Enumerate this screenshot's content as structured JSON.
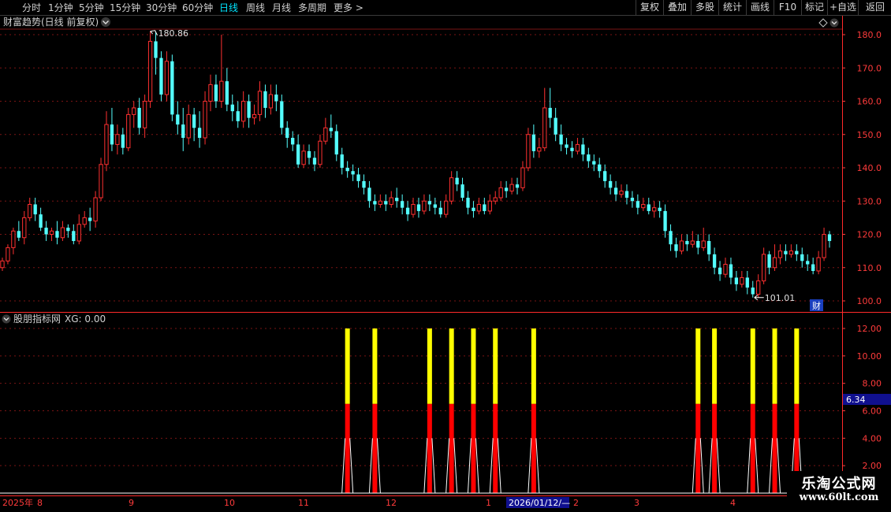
{
  "toolbar": {
    "periods": [
      {
        "label": "分时",
        "active": false
      },
      {
        "label": "1分钟",
        "active": false
      },
      {
        "label": "5分钟",
        "active": false
      },
      {
        "label": "15分钟",
        "active": false
      },
      {
        "label": "30分钟",
        "active": false
      },
      {
        "label": "60分钟",
        "active": false
      },
      {
        "label": "日线",
        "active": true
      },
      {
        "label": "周线",
        "active": false
      },
      {
        "label": "月线",
        "active": false
      },
      {
        "label": "多周期",
        "active": false
      },
      {
        "label": "更多 >",
        "active": false
      }
    ],
    "right_buttons": [
      "复权",
      "叠加",
      "多股",
      "统计",
      "画线",
      "F10",
      "标记",
      "+自选",
      "返回"
    ]
  },
  "main_panel": {
    "title": "财富趋势(日线 前复权)",
    "high_label": "180.86",
    "low_label": "101.01",
    "cai_badge": "财",
    "y_ticks": [
      "180.0",
      "170.0",
      "160.0",
      "150.0",
      "140.0",
      "130.0",
      "120.0",
      "110.0",
      "100.0"
    ]
  },
  "indicator_panel": {
    "title": "股朋指标网",
    "xg_label": "XG: 0.00",
    "cursor_value": "6.34",
    "y_ticks": [
      "12.00",
      "10.00",
      "8.00",
      "6.00",
      "4.00",
      "2.00"
    ]
  },
  "date_axis": {
    "labels": [
      "2025年",
      "8",
      "9",
      "10",
      "11",
      "12",
      "1",
      "2026/01/12/—",
      "2",
      "3",
      "4"
    ]
  },
  "watermark": {
    "line1": "乐淘公式网",
    "line2": "www.60lt.com"
  },
  "colors": {
    "up": "#ff3030",
    "down": "#54ffff",
    "signal_top": "#ffff00",
    "signal_bottom": "#ff0000",
    "axis": "#ff3b3b",
    "grid": "#7a1414"
  },
  "chart_data": {
    "type": "candlestick",
    "ylim": [
      99,
      183
    ],
    "candles": [
      [
        110,
        112,
        113,
        109
      ],
      [
        112,
        116,
        117,
        111
      ],
      [
        116,
        121,
        122,
        114
      ],
      [
        121,
        119,
        124,
        118
      ],
      [
        119,
        125,
        127,
        117
      ],
      [
        125,
        129,
        131,
        124
      ],
      [
        129,
        126,
        131,
        124
      ],
      [
        126,
        122,
        128,
        121
      ],
      [
        122,
        120,
        124,
        118
      ],
      [
        120,
        121,
        122,
        118
      ],
      [
        121,
        119,
        124,
        117
      ],
      [
        119,
        122,
        124,
        118
      ],
      [
        122,
        121,
        123,
        119
      ],
      [
        121,
        118,
        123,
        117
      ],
      [
        118,
        123,
        126,
        117
      ],
      [
        123,
        125,
        127,
        122
      ],
      [
        125,
        124,
        128,
        121
      ],
      [
        124,
        131,
        133,
        122
      ],
      [
        131,
        141,
        143,
        130
      ],
      [
        141,
        153,
        157,
        139
      ],
      [
        153,
        147,
        158,
        145
      ],
      [
        147,
        150,
        153,
        144
      ],
      [
        150,
        146,
        152,
        144
      ],
      [
        146,
        156,
        158,
        145
      ],
      [
        156,
        158,
        160,
        152
      ],
      [
        158,
        152,
        161,
        150
      ],
      [
        152,
        160,
        162,
        149
      ],
      [
        160,
        178,
        181,
        158
      ],
      [
        178,
        173,
        181,
        168
      ],
      [
        173,
        162,
        175,
        160
      ],
      [
        162,
        172,
        175,
        160
      ],
      [
        172,
        156,
        174,
        154
      ],
      [
        156,
        153,
        160,
        150
      ],
      [
        153,
        149,
        158,
        145
      ],
      [
        149,
        156,
        159,
        147
      ],
      [
        156,
        152,
        158,
        148
      ],
      [
        152,
        149,
        157,
        146
      ],
      [
        149,
        160,
        163,
        147
      ],
      [
        160,
        165,
        168,
        157
      ],
      [
        165,
        160,
        168,
        158
      ],
      [
        160,
        166,
        180,
        158
      ],
      [
        166,
        159,
        170,
        157
      ],
      [
        159,
        157,
        162,
        154
      ],
      [
        157,
        154,
        160,
        152
      ],
      [
        154,
        160,
        163,
        152
      ],
      [
        160,
        155,
        162,
        152
      ],
      [
        155,
        156,
        159,
        153
      ],
      [
        156,
        163,
        166,
        154
      ],
      [
        163,
        158,
        165,
        155
      ],
      [
        158,
        162,
        165,
        156
      ],
      [
        162,
        160,
        165,
        157
      ],
      [
        160,
        152,
        162,
        150
      ],
      [
        152,
        149,
        154,
        146
      ],
      [
        149,
        147,
        151,
        145
      ],
      [
        147,
        141,
        150,
        140
      ],
      [
        141,
        145,
        147,
        140
      ],
      [
        145,
        143,
        147,
        141
      ],
      [
        143,
        141,
        145,
        139
      ],
      [
        141,
        148,
        150,
        140
      ],
      [
        148,
        152,
        155,
        147
      ],
      [
        152,
        151,
        156,
        149
      ],
      [
        151,
        144,
        153,
        142
      ],
      [
        144,
        140,
        146,
        138
      ],
      [
        140,
        139,
        142,
        137
      ],
      [
        139,
        138,
        141,
        136
      ],
      [
        138,
        136,
        140,
        134
      ],
      [
        136,
        134,
        138,
        132
      ],
      [
        134,
        130,
        136,
        128
      ],
      [
        130,
        129,
        132,
        127
      ],
      [
        129,
        130,
        132,
        128
      ],
      [
        130,
        129,
        132,
        127
      ],
      [
        129,
        131,
        133,
        128
      ],
      [
        131,
        130,
        134,
        128
      ],
      [
        130,
        128,
        132,
        126
      ],
      [
        128,
        126,
        130,
        124
      ],
      [
        126,
        129,
        131,
        125
      ],
      [
        129,
        127,
        131,
        125
      ],
      [
        127,
        130,
        132,
        126
      ],
      [
        130,
        129,
        132,
        127
      ],
      [
        129,
        128,
        131,
        126
      ],
      [
        128,
        126,
        130,
        125
      ],
      [
        126,
        130,
        132,
        125
      ],
      [
        130,
        137,
        139,
        129
      ],
      [
        137,
        135,
        139,
        133
      ],
      [
        135,
        131,
        137,
        130
      ],
      [
        131,
        128,
        133,
        126
      ],
      [
        128,
        127,
        130,
        125
      ],
      [
        127,
        129,
        131,
        126
      ],
      [
        129,
        127,
        131,
        126
      ],
      [
        127,
        130,
        132,
        126
      ],
      [
        130,
        131,
        133,
        129
      ],
      [
        131,
        134,
        136,
        130
      ],
      [
        134,
        133,
        136,
        131
      ],
      [
        133,
        135,
        137,
        132
      ],
      [
        135,
        134,
        137,
        132
      ],
      [
        134,
        140,
        142,
        133
      ],
      [
        140,
        150,
        152,
        139
      ],
      [
        150,
        145,
        153,
        143
      ],
      [
        145,
        146,
        149,
        143
      ],
      [
        146,
        158,
        164,
        145
      ],
      [
        158,
        155,
        164,
        152
      ],
      [
        155,
        150,
        158,
        148
      ],
      [
        150,
        147,
        153,
        145
      ],
      [
        147,
        146,
        149,
        144
      ],
      [
        146,
        145,
        148,
        143
      ],
      [
        145,
        147,
        149,
        144
      ],
      [
        147,
        144,
        149,
        142
      ],
      [
        144,
        142,
        146,
        140
      ],
      [
        142,
        141,
        144,
        139
      ],
      [
        141,
        139,
        143,
        137
      ],
      [
        139,
        136,
        141,
        134
      ],
      [
        136,
        134,
        138,
        132
      ],
      [
        134,
        132,
        136,
        130
      ],
      [
        132,
        133,
        135,
        131
      ],
      [
        133,
        131,
        135,
        129
      ],
      [
        131,
        130,
        133,
        128
      ],
      [
        130,
        128,
        132,
        126
      ],
      [
        128,
        129,
        131,
        127
      ],
      [
        129,
        127,
        131,
        126
      ],
      [
        127,
        128,
        130,
        125
      ],
      [
        128,
        127,
        130,
        125
      ],
      [
        127,
        121,
        129,
        119
      ],
      [
        121,
        117,
        123,
        115
      ],
      [
        117,
        115,
        119,
        113
      ],
      [
        115,
        118,
        120,
        114
      ],
      [
        118,
        117,
        120,
        115
      ],
      [
        117,
        118,
        121,
        116
      ],
      [
        118,
        116,
        120,
        114
      ],
      [
        116,
        118,
        122,
        115
      ],
      [
        118,
        114,
        120,
        112
      ],
      [
        114,
        110,
        116,
        108
      ],
      [
        110,
        108,
        112,
        106
      ],
      [
        108,
        111,
        113,
        107
      ],
      [
        111,
        107,
        113,
        105
      ],
      [
        107,
        105,
        109,
        103
      ],
      [
        105,
        107,
        109,
        104
      ],
      [
        107,
        104,
        109,
        102
      ],
      [
        104,
        102,
        106,
        101
      ],
      [
        102,
        106,
        108,
        101
      ],
      [
        106,
        114,
        116,
        105
      ],
      [
        114,
        110,
        115,
        108
      ],
      [
        110,
        113,
        117,
        109
      ],
      [
        113,
        115,
        117,
        111
      ],
      [
        115,
        114,
        117,
        112
      ],
      [
        114,
        115,
        117,
        113
      ],
      [
        115,
        114,
        117,
        112
      ],
      [
        114,
        112,
        116,
        110
      ],
      [
        112,
        111,
        114,
        109
      ],
      [
        111,
        109,
        113,
        108
      ],
      [
        109,
        113,
        115,
        108
      ],
      [
        113,
        120,
        122,
        112
      ],
      [
        120,
        118,
        121,
        116
      ]
    ],
    "indicator": {
      "signal_indices": [
        63,
        68,
        78,
        82,
        86,
        90,
        97,
        127,
        130,
        137,
        141,
        145
      ],
      "signal_high": 12,
      "signal_mid": 6.5
    }
  }
}
